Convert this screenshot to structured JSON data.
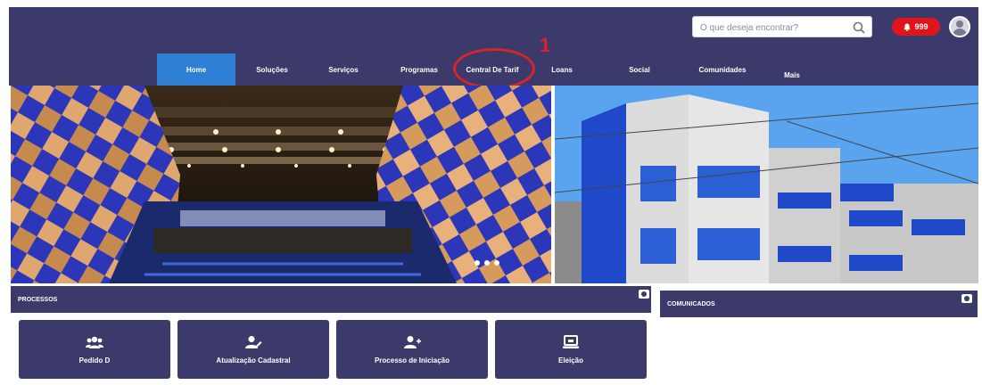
{
  "header": {
    "search_placeholder": "O que deseja encontrar?",
    "alert_badge": "999",
    "callout_number": "1"
  },
  "nav": {
    "items": [
      {
        "label": "Home",
        "active": true
      },
      {
        "label": "Soluções"
      },
      {
        "label": "Serviços"
      },
      {
        "label": "Programas"
      },
      {
        "label": "Central De Tarif"
      },
      {
        "label": "Loans"
      },
      {
        "label": "Social"
      },
      {
        "label": "Comunidades"
      },
      {
        "label": "Mais"
      }
    ]
  },
  "processos": {
    "title": "PROCESSOS",
    "cards": [
      {
        "label": "Pedido D",
        "icon": "users-icon"
      },
      {
        "label": "Atualização Cadastral",
        "icon": "user-edit-icon"
      },
      {
        "label": "Processo de Iniciação",
        "icon": "user-add-icon"
      },
      {
        "label": "Eleição",
        "icon": "monitor-icon"
      }
    ]
  },
  "comunicados": {
    "title": "COMUNICADOS"
  },
  "colors": {
    "navy": "#3b3a6b",
    "active_tab": "#2f7fd4",
    "alert_red": "#e0141b",
    "annotation_red": "#d8232a"
  }
}
